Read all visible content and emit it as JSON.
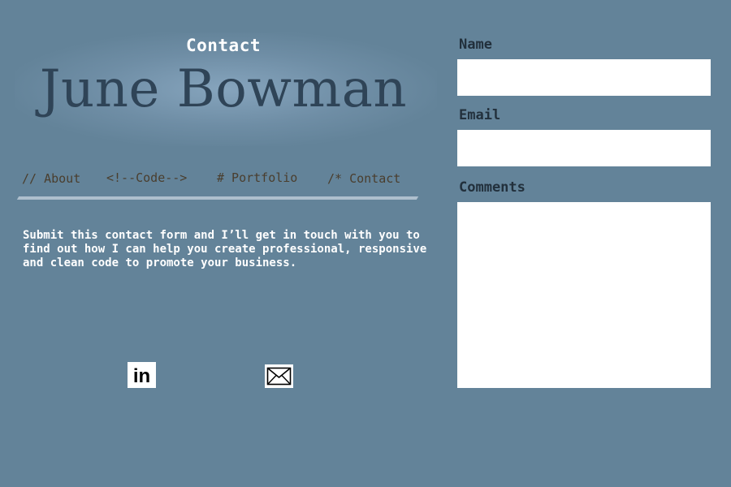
{
  "header": {
    "page_label": "Contact",
    "site_name": "June Bowman"
  },
  "nav": {
    "items": [
      {
        "label": "// About"
      },
      {
        "label": "<!--Code-->"
      },
      {
        "label": "# Portfolio"
      },
      {
        "label": "/* Contact"
      }
    ]
  },
  "intro": {
    "text": "Submit this contact form and I’ll get in touch with you to find out how I can help you create professional, responsive and clean code to promote your business."
  },
  "social": {
    "linkedin_icon": "linkedin-icon",
    "linkedin_text": "in",
    "email_icon": "envelope-icon"
  },
  "form": {
    "name_label": "Name",
    "name_value": "",
    "email_label": "Email",
    "email_value": "",
    "comments_label": "Comments",
    "comments_value": ""
  },
  "colors": {
    "background": "#638399",
    "title": "#2f4457",
    "nav_link": "#4a3e2e",
    "form_label": "#22303c"
  }
}
